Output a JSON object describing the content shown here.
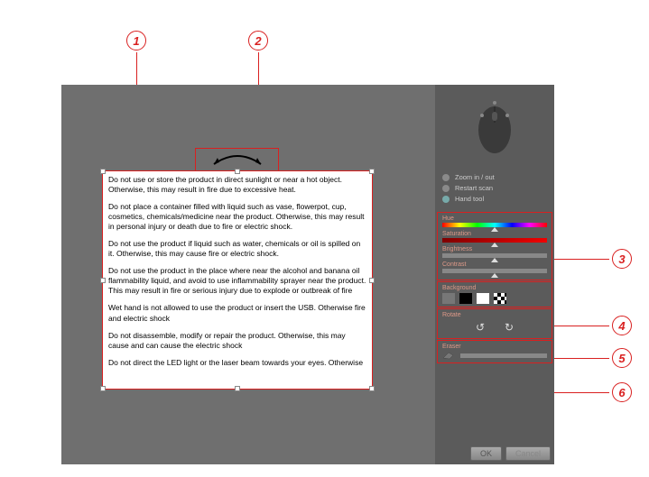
{
  "callouts": {
    "c1": "1",
    "c2": "2",
    "c3": "3",
    "c4": "4",
    "c5": "5",
    "c6": "6"
  },
  "document": {
    "p1": "Do not use or store the product in direct sunlight or near a hot object. Otherwise, this may result in fire due to excessive heat.",
    "p2": "Do not place a container filled with liquid such as vase, flowerpot, cup, cosmetics, chemicals/medicine near the product. Otherwise, this may result in personal injury or death due to fire or electric shock.",
    "p3": "Do not use the product if liquid such as water, chemicals or oil is spilled on it. Otherwise, this may cause fire or electric shock.",
    "p4": "Do not use the product in the place where near the alcohol and banana oil flammability liquid, and avoid to use inflammability sprayer near the product. This may result in fire or serious injury due to explode or outbreak of fire",
    "p5": "Wet hand is not allowed to use the product or insert the USB. Otherwise fire and electric shock",
    "p6": "Do not disassemble, modify or repair the product. Otherwise, this may cause and can cause the electric shock",
    "p7": "Do not direct the LED light or the laser beam towards your eyes. Otherwise"
  },
  "tools": {
    "zoom": "Zoom in / out",
    "restart": "Restart scan",
    "hand": "Hand tool"
  },
  "panels": {
    "hue": "Hue",
    "saturation": "Saturation",
    "brightness": "Brightness",
    "contrast": "Contrast",
    "background": "Background",
    "rotate": "Rotate",
    "eraser": "Eraser"
  },
  "buttons": {
    "ok": "OK",
    "cancel": "Cancel"
  }
}
